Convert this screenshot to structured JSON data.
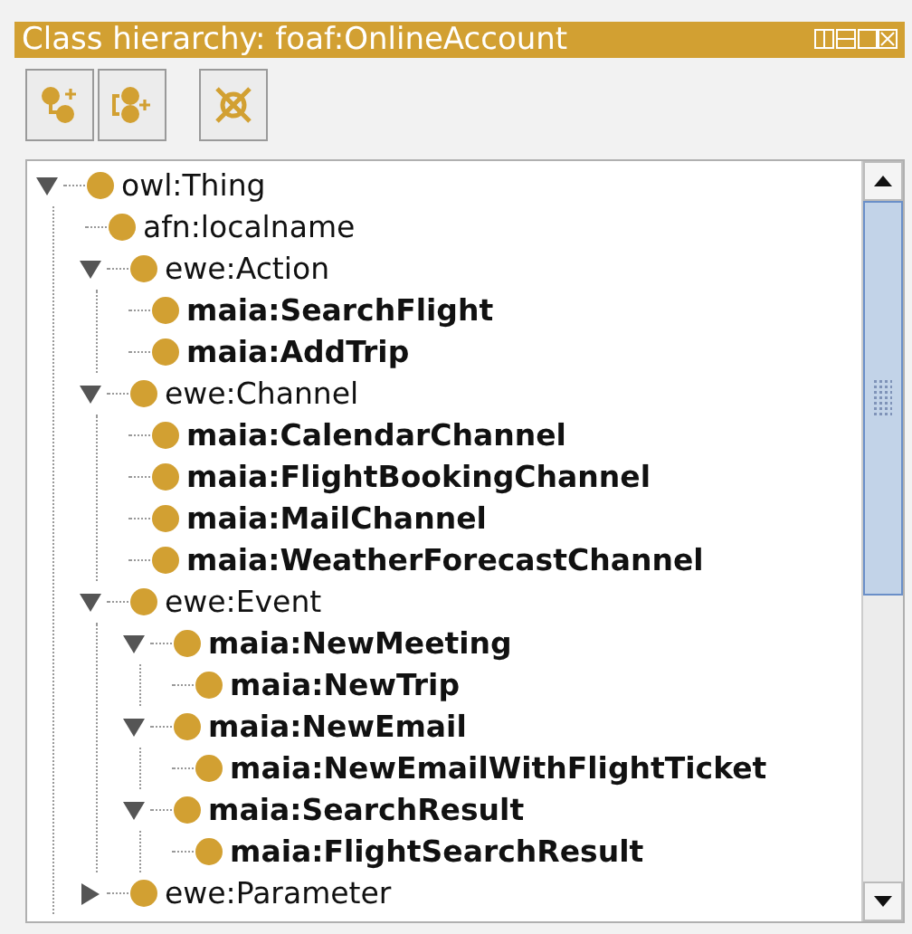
{
  "panel": {
    "title": "Class hierarchy: foaf:OnlineAccount"
  },
  "toolbar": [
    {
      "kind": "add-subclass"
    },
    {
      "kind": "add-sibling"
    },
    {
      "kind": "delete"
    }
  ],
  "tree": [
    {
      "label": "owl:Thing",
      "emphasized": false,
      "expanded": true,
      "children": [
        {
          "label": "afn:localname",
          "emphasized": false
        },
        {
          "label": "ewe:Action",
          "emphasized": false,
          "expanded": true,
          "children": [
            {
              "label": "maia:SearchFlight",
              "emphasized": true
            },
            {
              "label": "maia:AddTrip",
              "emphasized": true
            }
          ]
        },
        {
          "label": "ewe:Channel",
          "emphasized": false,
          "expanded": true,
          "children": [
            {
              "label": "maia:CalendarChannel",
              "emphasized": true
            },
            {
              "label": "maia:FlightBookingChannel",
              "emphasized": true
            },
            {
              "label": "maia:MailChannel",
              "emphasized": true
            },
            {
              "label": "maia:WeatherForecastChannel",
              "emphasized": true
            }
          ]
        },
        {
          "label": "ewe:Event",
          "emphasized": false,
          "expanded": true,
          "children": [
            {
              "label": "maia:NewMeeting",
              "emphasized": true,
              "expanded": true,
              "children": [
                {
                  "label": "maia:NewTrip",
                  "emphasized": true
                }
              ]
            },
            {
              "label": "maia:NewEmail",
              "emphasized": true,
              "expanded": true,
              "children": [
                {
                  "label": "maia:NewEmailWithFlightTicket",
                  "emphasized": true
                }
              ]
            },
            {
              "label": "maia:SearchResult",
              "emphasized": true,
              "expanded": true,
              "children": [
                {
                  "label": "maia:FlightSearchResult",
                  "emphasized": true
                }
              ]
            }
          ]
        },
        {
          "label": "ewe:Parameter",
          "emphasized": false,
          "expanded": false
        }
      ]
    }
  ]
}
